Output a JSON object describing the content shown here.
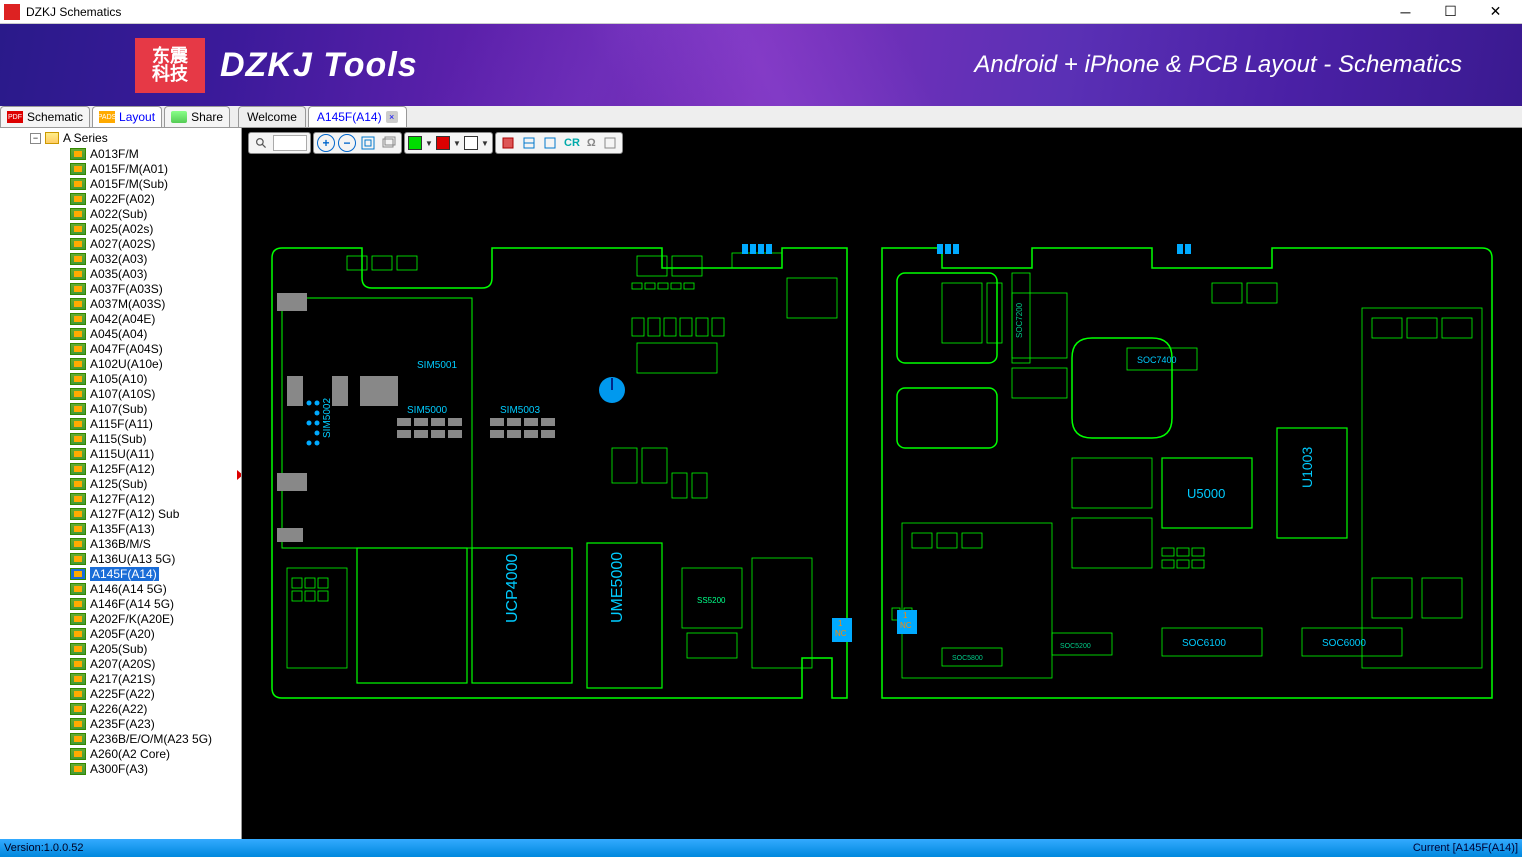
{
  "window": {
    "title": "DZKJ Schematics"
  },
  "banner": {
    "logo_text": "东震\n科技",
    "brand": "DZKJ Tools",
    "tagline": "Android + iPhone & PCB Layout - Schematics"
  },
  "maintabs": {
    "schematic": "Schematic",
    "layout": "Layout",
    "share": "Share"
  },
  "doctabs": [
    {
      "label": "Welcome",
      "active": false,
      "closable": false
    },
    {
      "label": "A145F(A14)",
      "active": true,
      "closable": true
    }
  ],
  "tree": {
    "root": "A Series",
    "items": [
      "A013F/M",
      "A015F/M(A01)",
      "A015F/M(Sub)",
      "A022F(A02)",
      "A022(Sub)",
      "A025(A02s)",
      "A027(A02S)",
      "A032(A03)",
      "A035(A03)",
      "A037F(A03S)",
      "A037M(A03S)",
      "A042(A04E)",
      "A045(A04)",
      "A047F(A04S)",
      "A102U(A10e)",
      "A105(A10)",
      "A107(A10S)",
      "A107(Sub)",
      "A115F(A11)",
      "A115(Sub)",
      "A115U(A11)",
      "A125F(A12)",
      "A125(Sub)",
      "A127F(A12)",
      "A127F(A12) Sub",
      "A135F(A13)",
      "A136B/M/S",
      "A136U(A13 5G)",
      "A145F(A14)",
      "A146(A14 5G)",
      "A146F(A14 5G)",
      "A202F/K(A20E)",
      "A205F(A20)",
      "A205(Sub)",
      "A207(A20S)",
      "A217(A21S)",
      "A225F(A22)",
      "A226(A22)",
      "A235F(A23)",
      "A236B/E/O/M(A23 5G)",
      "A260(A2 Core)",
      "A300F(A3)"
    ],
    "selected_index": 28
  },
  "toolbar": {
    "cr_label": "CR",
    "ohm_label": "Ω"
  },
  "pcb_labels": {
    "sim5001": "SIM5001",
    "sim5002": "SIM5002",
    "sim5000": "SIM5000",
    "sim5003": "SIM5003",
    "ucp4000": "UCP4000",
    "ume5000": "UME5000",
    "ss5200": "SS5200",
    "u5000": "U5000",
    "u1003": "U1003",
    "soc7400": "SOC7400",
    "soc7200": "SOC7200",
    "soc6100": "SOC6100",
    "soc6000": "SOC6000",
    "soc5200": "SOC5200",
    "soc5800": "SOC5800",
    "nc1": "1\nNC",
    "nc2": "1\nNC"
  },
  "status": {
    "version": "Version:1.0.0.52",
    "current": "Current [A145F(A14)]"
  }
}
